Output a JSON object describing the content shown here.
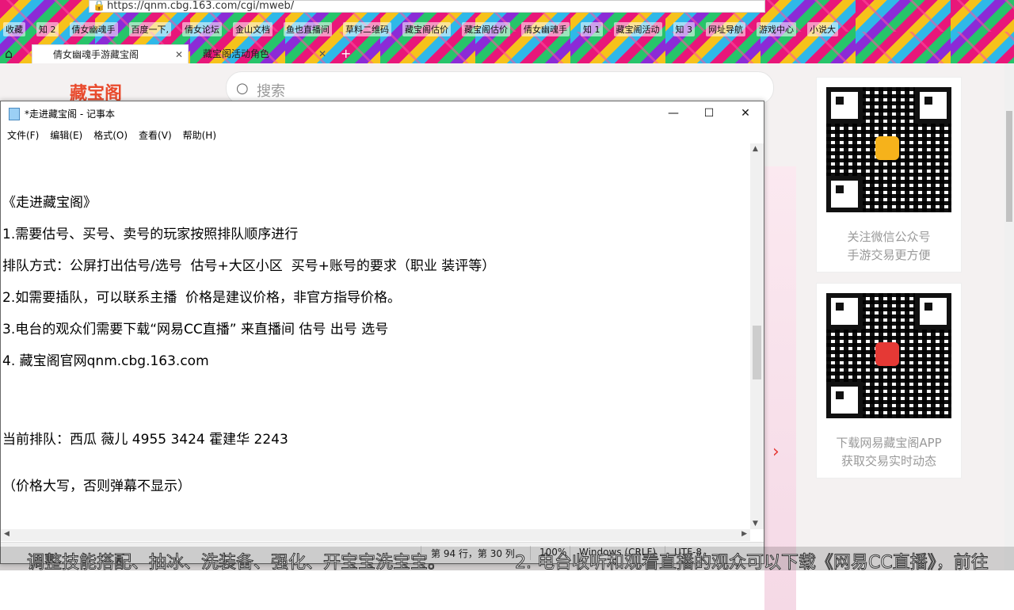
{
  "browser": {
    "url": "https://qnm.cbg.163.com/cgi/mweb/",
    "bookmarks": [
      "收藏",
      "知 2",
      "倩女幽魂手",
      "百度一下,",
      "倩女论坛",
      "金山文档",
      "鱼也直播间",
      "草料二维码",
      "藏宝阁估价",
      "藏宝阁估价",
      "倩女幽魂手",
      "知 1",
      "藏宝阁活动",
      "知 3",
      "网址导航",
      "游戏中心",
      "小说大"
    ],
    "tabs": [
      {
        "label": "倩女幽魂手游藏宝阁",
        "active": true
      },
      {
        "label": "藏宝阁活动角色",
        "active": false
      }
    ]
  },
  "page": {
    "logo_text": "藏宝阁",
    "search_placeholder": "搜索",
    "qr1_caption": [
      "关注微信公众号",
      "手游交易更方便"
    ],
    "qr2_caption": [
      "下载网易藏宝阁APP",
      "获取交易实时动态"
    ]
  },
  "notepad": {
    "title": "*走进藏宝阁 - 记事本",
    "menu": [
      "文件(F)",
      "编辑(E)",
      "格式(O)",
      "查看(V)",
      "帮助(H)"
    ],
    "lines": [
      "《走进藏宝阁》",
      "1.需要估号、买号、卖号的玩家按照排队顺序进行",
      "排队方式：公屏打出估号/选号  估号+大区小区  买号+账号的要求（职业 装评等）",
      "2.如需要插队，可以联系主播  价格是建议价格，非官方指导价格。",
      "3.电台的观众们需要下载“网易CC直播” 来直播间 估号 出号 选号",
      "4. 藏宝阁官网qnm.cbg.163.com",
      "当前排队：西瓜 薇儿 4955 3424 霍建华 2243",
      "（价格大写，否则弹幕不显示）"
    ],
    "status": {
      "position": "第 94 行，第 30 列",
      "zoom": "100%",
      "line_ending": "Windows (CRLF)",
      "encoding": "UTF-8"
    }
  },
  "subtitle": {
    "left": "调整技能搭配、抽冰、洗装备、强化、开宝宝洗宝宝。",
    "right": "2. 电台收听和观看直播的观众可以下载《网易CC直播》，前往"
  }
}
